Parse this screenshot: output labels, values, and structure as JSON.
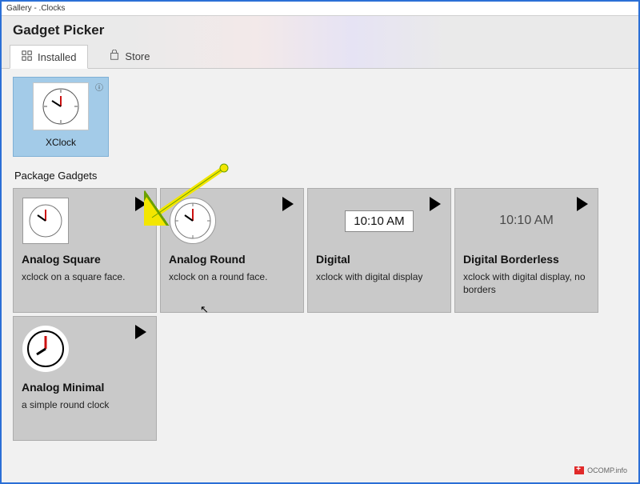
{
  "window": {
    "title": "Gallery - .Clocks"
  },
  "header": {
    "title": "Gadget Picker"
  },
  "tabs": [
    {
      "id": "installed",
      "label": "Installed",
      "active": true
    },
    {
      "id": "store",
      "label": "Store",
      "active": false
    }
  ],
  "installed": {
    "items": [
      {
        "id": "xclock",
        "label": "XClock"
      }
    ]
  },
  "section_title": "Package Gadgets",
  "gadgets": [
    {
      "id": "analog-square",
      "title": "Analog Square",
      "desc": "xclock on a square face.",
      "face": "square-clock"
    },
    {
      "id": "analog-round",
      "title": "Analog Round",
      "desc": "xclock on a round face.",
      "face": "round-clock"
    },
    {
      "id": "digital",
      "title": "Digital",
      "desc": "xclock with digital display",
      "face": "digital-box",
      "time_text": "10:10 AM"
    },
    {
      "id": "digital-borderless",
      "title": "Digital Borderless",
      "desc": "xclock with digital display, no borders",
      "face": "digital-text",
      "time_text": "10:10 AM"
    },
    {
      "id": "analog-minimal",
      "title": "Analog Minimal",
      "desc": "a simple round clock",
      "face": "minimal-clock"
    }
  ],
  "watermark": {
    "text": "OCOMP.info"
  }
}
